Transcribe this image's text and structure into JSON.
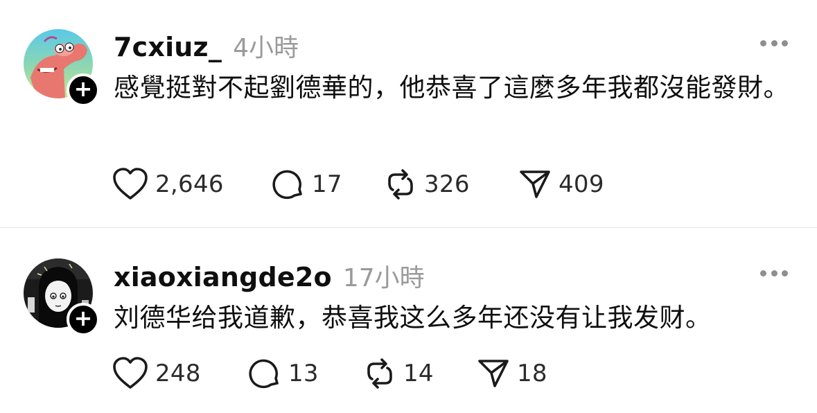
{
  "posts": [
    {
      "username": "7cxiuz_",
      "time": "4小時",
      "text": "感覺挺對不起劉德華的，他恭喜了這麼多年我都沒能發財。",
      "follow_symbol": "+",
      "likes": "2,646",
      "replies": "17",
      "reposts": "326",
      "shares": "409"
    },
    {
      "username": "xiaoxiangde2o",
      "time": "17小時",
      "text": "刘德华给我道歉，恭喜我这么多年还没有让我发财。",
      "follow_symbol": "+",
      "likes": "248",
      "replies": "13",
      "reposts": "14",
      "shares": "18"
    }
  ],
  "colors": {
    "background": "#ffffff",
    "text": "#0f0f0f",
    "muted": "#9a9a9a",
    "divider": "#e3e3e3",
    "badge": "#000000"
  },
  "icons": [
    "heart-icon",
    "reply-icon",
    "repost-icon",
    "share-icon",
    "more-icon"
  ]
}
